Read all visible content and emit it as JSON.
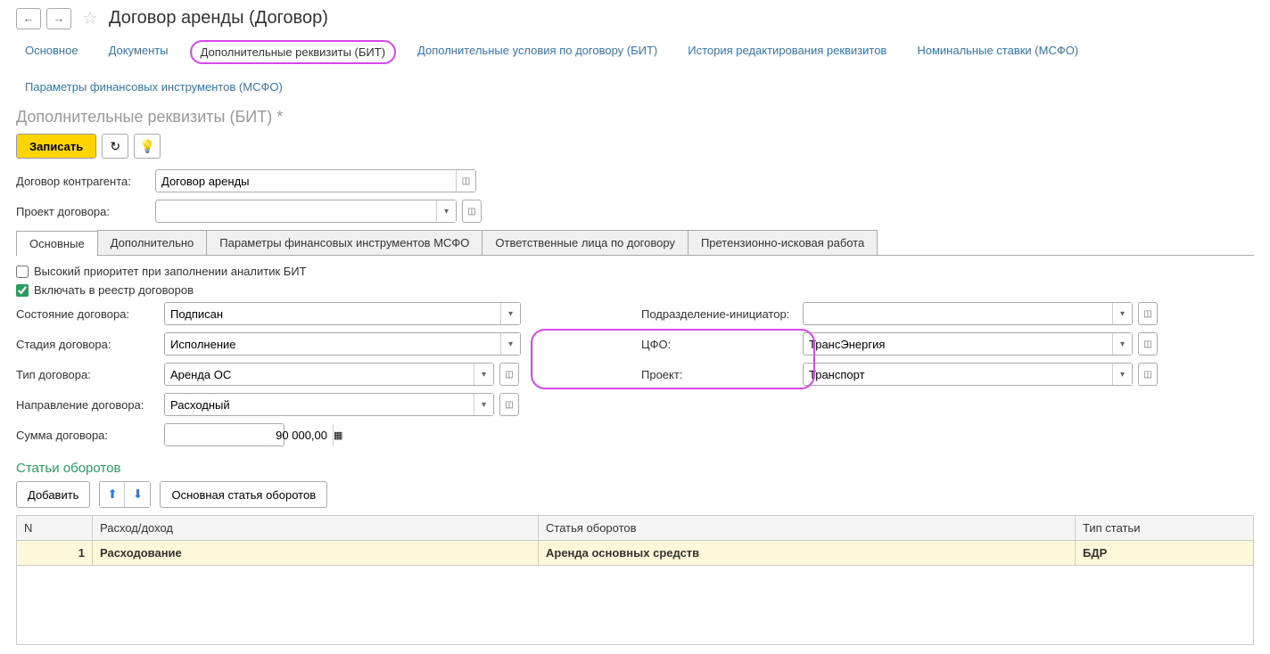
{
  "header": {
    "title": "Договор аренды (Договор)"
  },
  "navTabs": {
    "main": "Основное",
    "docs": "Документы",
    "reqBit": "Дополнительные реквизиты (БИТ)",
    "extraCond": "Дополнительные условия по договору (БИТ)",
    "editHist": "История редактирования реквизитов",
    "nominal": "Номинальные ставки (МСФО)",
    "finParams": "Параметры финансовых инструментов (МСФО)"
  },
  "subtitle": "Дополнительные реквизиты (БИТ) *",
  "toolbar": {
    "save": "Записать"
  },
  "form": {
    "contractLabel": "Договор контрагента:",
    "contractValue": "Договор аренды",
    "projectLabel": "Проект договора:",
    "projectValue": ""
  },
  "tabs2": {
    "t1": "Основные",
    "t2": "Дополнительно",
    "t3": "Параметры финансовых инструментов МСФО",
    "t4": "Ответственные лица по договору",
    "t5": "Претензионно-исковая работа"
  },
  "checks": {
    "highPriority": "Высокий приоритет при заполнении аналитик БИТ",
    "includeReg": "Включать в реестр договоров"
  },
  "fields": {
    "stateLabel": "Состояние договора:",
    "stateValue": "Подписан",
    "stageLabel": "Стадия договора:",
    "stageValue": "Исполнение",
    "typeLabel": "Тип договора:",
    "typeValue": "Аренда ОС",
    "dirLabel": "Направление договора:",
    "dirValue": "Расходный",
    "sumLabel": "Сумма договора:",
    "sumValue": "90 000,00",
    "subdivLabel": "Подразделение-инициатор:",
    "subdivValue": "",
    "cfoLabel": "ЦФО:",
    "cfoValue": "ТрансЭнергия",
    "projLabel": "Проект:",
    "projValue": "Транспорт"
  },
  "turnover": {
    "title": "Статьи оборотов",
    "add": "Добавить",
    "mainArticle": "Основная статья оборотов",
    "colN": "N",
    "colExp": "Расход/доход",
    "colArt": "Статья оборотов",
    "colType": "Тип статьи",
    "row": {
      "n": "1",
      "exp": "Расходование",
      "art": "Аренда основных средств",
      "type": "БДР"
    }
  }
}
